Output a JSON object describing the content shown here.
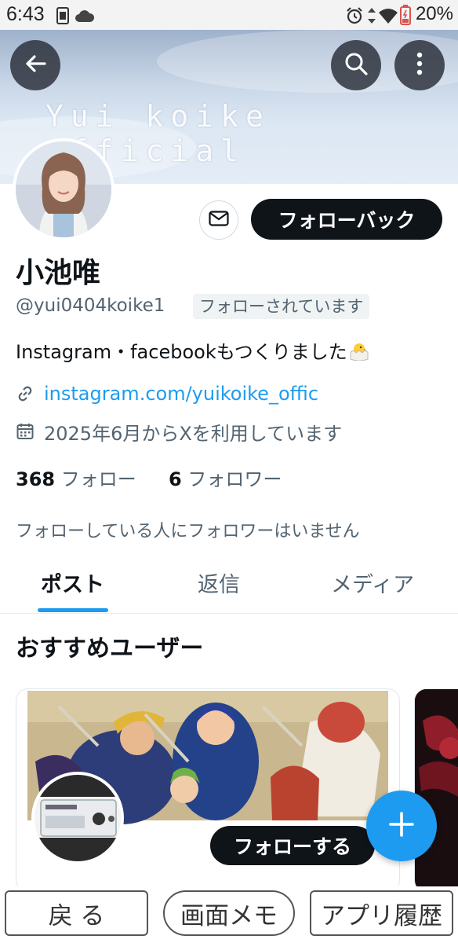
{
  "status_bar": {
    "time": "6:43",
    "battery": "20%",
    "icons": [
      "sim-icon",
      "cloud-icon",
      "alarm-icon",
      "data-arrows-icon",
      "wifi-icon",
      "battery-icon"
    ]
  },
  "header": {
    "banner_text": "Yui koike official",
    "back_icon": "arrow-left-icon",
    "search_icon": "search-icon",
    "more_icon": "more-vertical-icon"
  },
  "profile": {
    "name": "小池唯",
    "handle": "@yui0404koike1",
    "follows_you_badge": "フォローされています",
    "bio": "Instagram・facebookもつくりました",
    "link": "instagram.com/yuikoike_offic",
    "joined": "2025年6月からXを利用しています",
    "following_count": "368",
    "following_label": "フォロー",
    "followers_count": "6",
    "followers_label": "フォロワー",
    "followers_note": "フォローしている人にフォロワーはいません",
    "followback_label": "フォローバック",
    "message_icon": "mail-icon"
  },
  "tabs": [
    {
      "label": "ポスト",
      "active": true
    },
    {
      "label": "返信",
      "active": false
    },
    {
      "label": "メディア",
      "active": false
    }
  ],
  "recommended": {
    "title": "おすすめユーザー",
    "follow_label": "フォローする"
  },
  "fab_icon": "plus-icon",
  "bottom_nav": {
    "back": "戻 る",
    "memo": "画面メモ",
    "history": "アプリ履歴"
  },
  "colors": {
    "accent": "#1d9bf0",
    "primary_button": "#0f1419",
    "secondary_text": "#536471"
  }
}
